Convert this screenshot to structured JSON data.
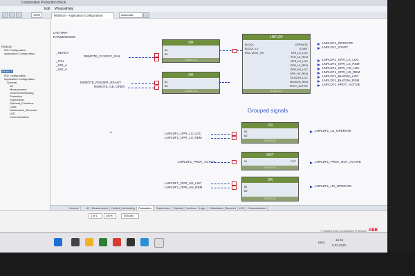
{
  "window": {
    "title": "Composition Protection Block"
  },
  "menu": [
    "Edit",
    "Window",
    "Help"
  ],
  "toolbar": {
    "zoom": "100%",
    "combo": "Automatic"
  },
  "doc_tab": "REB615 - Application Configuration",
  "tree": {
    "items": [
      "REB615",
      "IED Configuration",
      "Application Configuration",
      "REB615",
      "IED Configuration",
      "Application Configuration",
      "General",
      "LD",
      "Measurement",
      "Control Interlocking",
      "Protection",
      "Supervision",
      "Optional_Functions",
      "Logic",
      "Disturbance_Recorder",
      "LED",
      "Communication"
    ],
    "selected_index": 3
  },
  "left_signals": [
    "LAN TRIP",
    "RANSMISSION",
    "_READY",
    "_FAIL",
    "_SIG_A",
    "_SIG_A"
  ],
  "inputs": {
    "remote_ccspvc_fail": "REMOTE_CCSPVC_FAIL",
    "remote_feeder_ready": "REMOTE_FEEDER_READY",
    "remote_cb_open": "REMOTE_CB_OPEN",
    "ls_loc": "LNPLDF1_OPR_LS_LOC",
    "ls_rem": "LNPLDF1_OPR_LS_REM",
    "prot_active": "LNPLDF1_PROT_ACTIVE",
    "hs_loc": "LNPLDF1_OPR_HS_LOC",
    "hs_rem": "LNPLDF1_OPR_HS_REM"
  },
  "blocks": {
    "or1": {
      "title": "OR",
      "pins": [
        "B1",
        "B2"
      ],
      "footer": "0.0/12.2.6"
    },
    "or2": {
      "title": "OR",
      "pins": [
        "B1",
        "B2"
      ],
      "footer": "0.0/12.2.6"
    },
    "main": {
      "title": "LNPLDF",
      "pins_in": [
        "BLOCK",
        "BLOCK_LS",
        "ENA_MULT_HS"
      ],
      "footer": "0.0/12.2.6"
    },
    "or3": {
      "title": "OR",
      "pins": [
        "B1",
        "B2"
      ],
      "footer": "0.0/12.2.6"
    },
    "not1": {
      "title": "NOT",
      "pin_in": "IN",
      "pin_out": "OUT",
      "footer": "0.0/12.2.6"
    },
    "or4": {
      "title": "OR",
      "pins": [
        "B1",
        "B2"
      ],
      "footer": "0.0/12.2.6"
    }
  },
  "main_outputs": [
    "OPERATE",
    "START",
    "STR_LS_LOC",
    "STR_LS_REM",
    "OPR_LS_LOC",
    "OPR_LS_REM",
    "OPR_HS_LOC",
    "OPR_HS_REM",
    "BLKD2H_LOC",
    "BLKD2H_REM",
    "PROT_ACTIVE"
  ],
  "output_signals": [
    "LNPLDF1_OPERATE",
    "LNPLDF1_START",
    "LNPLDF1_OPR_LS_LOC",
    "LNPLDF1_OPR_LS_REM",
    "LNPLDF1_OPR_HS_LOC",
    "LNPLDF1_OPR_HS_REM",
    "LNPLDF1_BLKD2H_LOC",
    "LNPLDF1_BLKD2H_REM",
    "LNPLDF1_PROT_ACTIVE"
  ],
  "grouped_title": "Grouped signals",
  "grouped_outputs": {
    "ls_operate": "LNPLDF1_LS_OPERATE",
    "prot_not_active": "LNPLDF1_PROT_NOT_ACTIVE",
    "hs_operate": "LNPLDF1_HS_OPERATE"
  },
  "bottom_tabs": [
    "General",
    "LD",
    "Measurement",
    "Control_Interlocking",
    "Protection",
    "Supervision",
    "Optional_Functions",
    "Logic",
    "Disturbance_Recorder",
    "LED",
    "Communication"
  ],
  "active_bottom_tab": "Protection",
  "status": {
    "page": "1 of 1",
    "zoom": "100%",
    "position": "TESLIN5"
  },
  "copyright": "© Subject 2020 Composition Protection",
  "brand": "ABB",
  "clock": {
    "time": "13:54",
    "date": "5.02.2020"
  },
  "tray_lang": "ENG",
  "colors": {
    "block_header": "#6f8f3e",
    "wire": "#2441b5",
    "grouped_title": "#3f58c9",
    "brand": "#e2001a"
  }
}
